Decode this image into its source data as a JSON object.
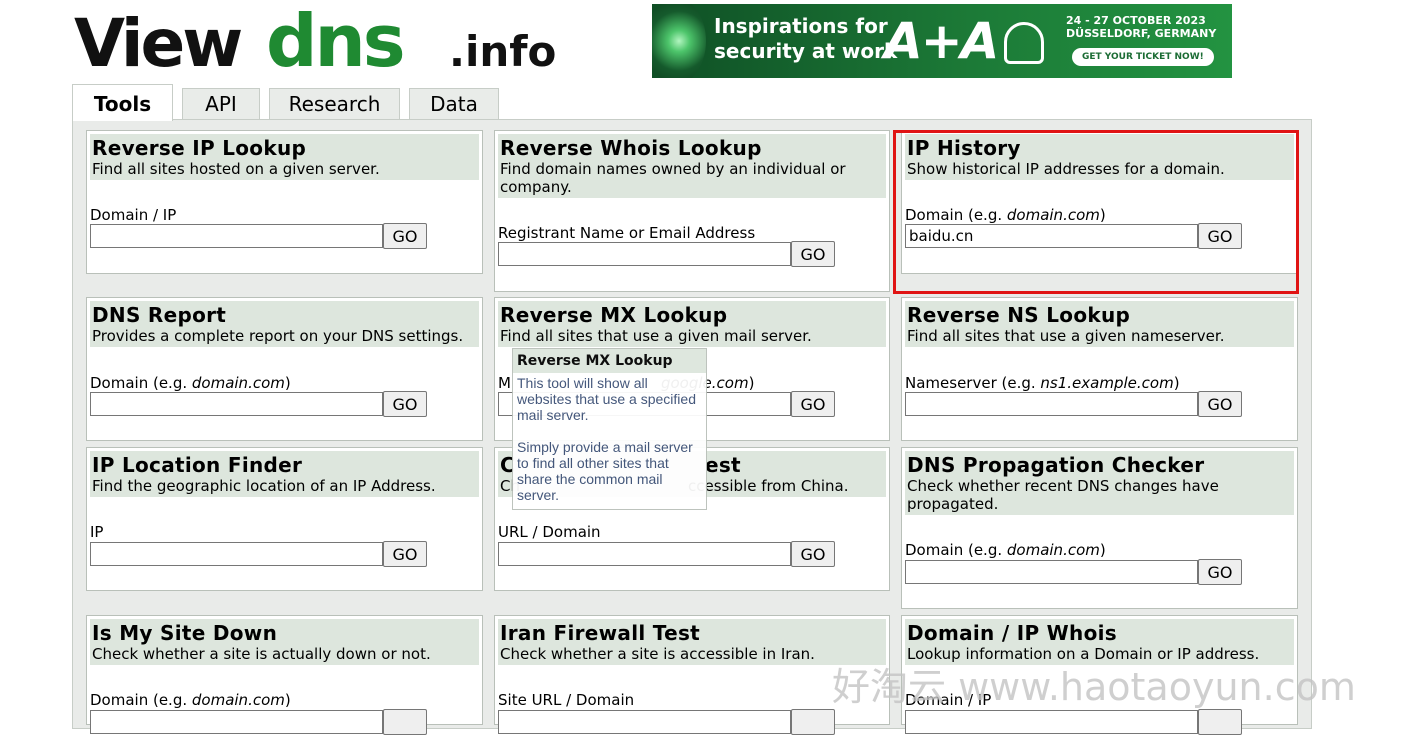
{
  "logo": {
    "view": "View",
    "dns": "dns",
    "info": ".info"
  },
  "ad": {
    "headline_line1": "Inspirations for",
    "headline_line2": "security at work",
    "brand": "A+A",
    "date_line1": "24 - 27 OCTOBER 2023",
    "date_line2": "DÜSSELDORF, GERMANY",
    "cta": "GET YOUR TICKET NOW!"
  },
  "tabs": [
    {
      "label": "Tools",
      "active": true
    },
    {
      "label": "API",
      "active": false
    },
    {
      "label": "Research",
      "active": false
    },
    {
      "label": "Data",
      "active": false
    }
  ],
  "cards": {
    "reverse_ip": {
      "title": "Reverse IP Lookup",
      "desc": "Find all sites hosted on a given server.",
      "label": "Domain / IP",
      "value": "",
      "go": "GO"
    },
    "reverse_whois": {
      "title": "Reverse Whois Lookup",
      "desc": "Find domain names owned by an individual or company.",
      "label": "Registrant Name or Email Address",
      "value": "",
      "go": "GO"
    },
    "ip_history": {
      "title": "IP History",
      "desc": "Show historical IP addresses for a domain.",
      "label": "Domain (e.g. ",
      "label_example": "domain.com",
      "label_end": ")",
      "value": "baidu.cn",
      "go": "GO"
    },
    "dns_report": {
      "title": "DNS Report",
      "desc": "Provides a complete report on your DNS settings.",
      "label": "Domain (e.g. ",
      "label_example": "domain.com",
      "label_end": ")",
      "value": "",
      "go": "GO"
    },
    "reverse_mx": {
      "title": "Reverse MX Lookup",
      "desc": "Find all sites that use a given mail server.",
      "label": "M",
      "label_example": "google.com",
      "label_end": ")",
      "value": "",
      "go": "GO"
    },
    "reverse_ns": {
      "title": "Reverse NS Lookup",
      "desc": "Find all sites that use a given nameserver.",
      "label": "Nameserver (e.g. ",
      "label_example": "ns1.example.com",
      "label_end": ")",
      "value": "",
      "go": "GO"
    },
    "ip_location": {
      "title": "IP Location Finder",
      "desc": "Find the geographic location of an IP Address.",
      "label": "IP",
      "value": "",
      "go": "GO"
    },
    "china_firewall": {
      "title_start": "C",
      "title_end": "est",
      "desc_start": "Ch",
      "desc_end": "ccessible from China.",
      "label": "URL / Domain",
      "value": "",
      "go": "GO"
    },
    "dns_propagation": {
      "title": "DNS Propagation Checker",
      "desc": "Check whether recent DNS changes have propagated.",
      "label": "Domain (e.g. ",
      "label_example": "domain.com",
      "label_end": ")",
      "value": "",
      "go": "GO"
    },
    "site_down": {
      "title": "Is My Site Down",
      "desc": "Check whether a site is actually down or not.",
      "label": "Domain (e.g. ",
      "label_example": "domain.com",
      "label_end": ")"
    },
    "iran_firewall": {
      "title": "Iran Firewall Test",
      "desc": "Check whether a site is accessible in Iran.",
      "label": "Site URL / Domain"
    },
    "domain_whois": {
      "title": "Domain / IP Whois",
      "desc": "Lookup information on a Domain or IP address.",
      "label": "Domain / IP"
    }
  },
  "tooltip": {
    "title": "Reverse MX Lookup",
    "para1": "This tool will show all websites that use a specified mail server.",
    "para2": "Simply provide a mail server to find all other sites that share the common mail server."
  },
  "watermark": "好淘云 www.haotaoyun.com",
  "colors": {
    "logo_green": "#1f8a32",
    "card_header": "#dde6dd",
    "highlight": "#e01414",
    "tooltip_text": "#3a4e74"
  }
}
